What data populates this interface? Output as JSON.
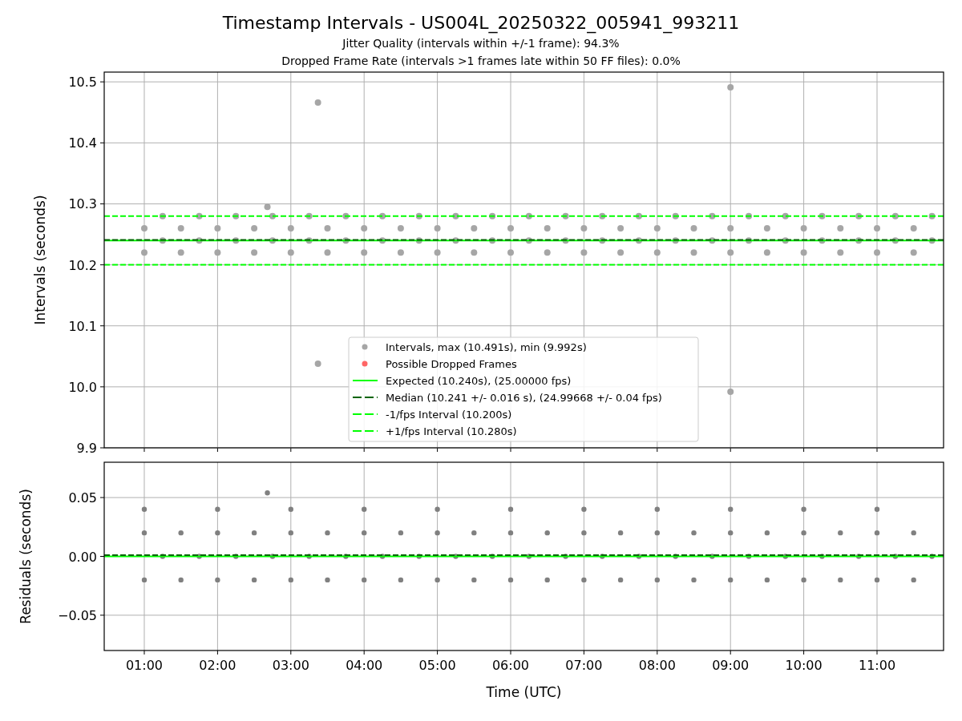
{
  "figure": {
    "title": "Timestamp Intervals - US004L_20250322_005941_993211",
    "subtitles": [
      "Jitter Quality (intervals within +/-1 frame): 94.3%",
      "Dropped Frame Rate (intervals >1 frames late within 50 FF files): 0.0%"
    ]
  },
  "intervals_plot": {
    "chart_data": {
      "type": "scatter",
      "ylabel": "Intervals (seconds)",
      "grid": true,
      "xlim": [
        0.453,
        11.908
      ],
      "ylim": [
        9.9,
        10.516
      ],
      "yticks": [
        {
          "value": 9.9,
          "label": "9.9"
        },
        {
          "value": 10.0,
          "label": "10.0"
        },
        {
          "value": 10.1,
          "label": "10.1"
        },
        {
          "value": 10.2,
          "label": "10.2"
        },
        {
          "value": 10.3,
          "label": "10.3"
        },
        {
          "value": 10.4,
          "label": "10.4"
        },
        {
          "value": 10.5,
          "label": "10.5"
        }
      ],
      "x": [
        1.0,
        1.5,
        2.0,
        2.5,
        3.0,
        3.5,
        4.0,
        4.5,
        5.0,
        5.5,
        6.0,
        6.5,
        7.0,
        7.5,
        8.0,
        8.5,
        9.0,
        9.5,
        10.0,
        10.5,
        11.0,
        11.5,
        1.25,
        1.75,
        2.25,
        2.75,
        3.25,
        3.75,
        4.25,
        4.75,
        5.25,
        5.75,
        6.25,
        6.75,
        7.25,
        7.75,
        8.25,
        8.75,
        9.25,
        9.75,
        10.25,
        10.75,
        11.25,
        11.75,
        1.0,
        1.5,
        2.0,
        2.5,
        3.0,
        3.5,
        4.0,
        4.5,
        5.0,
        5.5,
        6.0,
        6.5,
        7.0,
        7.5,
        8.0,
        8.5,
        9.0,
        9.5,
        10.0,
        10.5,
        11.0,
        11.5,
        1.25,
        1.75,
        2.25,
        2.75,
        3.25,
        3.75,
        4.25,
        4.75,
        5.25,
        5.75,
        6.25,
        6.75,
        7.25,
        7.75,
        8.25,
        8.75,
        9.25,
        9.75,
        10.25,
        10.75,
        11.25,
        11.75,
        2.68,
        3.37,
        3.37,
        9.0,
        9.0
      ],
      "series": [
        {
          "color": "#a6a6a6",
          "values": [
            10.22,
            10.22,
            10.22,
            10.22,
            10.22,
            10.22,
            10.22,
            10.22,
            10.22,
            10.22,
            10.22,
            10.22,
            10.22,
            10.22,
            10.22,
            10.22,
            10.22,
            10.22,
            10.22,
            10.22,
            10.22,
            10.22,
            10.24,
            10.24,
            10.24,
            10.24,
            10.24,
            10.24,
            10.24,
            10.24,
            10.24,
            10.24,
            10.24,
            10.24,
            10.24,
            10.24,
            10.24,
            10.24,
            10.24,
            10.24,
            10.24,
            10.24,
            10.24,
            10.24,
            10.26,
            10.26,
            10.26,
            10.26,
            10.26,
            10.26,
            10.26,
            10.26,
            10.26,
            10.26,
            10.26,
            10.26,
            10.26,
            10.26,
            10.26,
            10.26,
            10.26,
            10.26,
            10.26,
            10.26,
            10.26,
            10.26,
            10.28,
            10.28,
            10.28,
            10.28,
            10.28,
            10.28,
            10.28,
            10.28,
            10.28,
            10.28,
            10.28,
            10.28,
            10.28,
            10.28,
            10.28,
            10.28,
            10.28,
            10.28,
            10.28,
            10.28,
            10.28,
            10.28,
            10.295,
            10.466,
            10.038,
            10.491,
            9.992
          ]
        }
      ],
      "ref_lines": [
        {
          "axis": "y",
          "color": "#00ff00",
          "value": 10.24
        },
        {
          "axis": "y",
          "color": "#006400",
          "value": 10.241
        },
        {
          "axis": "y",
          "color": "#00ff00",
          "value": 10.2
        },
        {
          "axis": "y",
          "color": "#00ff00",
          "value": 10.28
        }
      ]
    },
    "legend": [
      {
        "kind": "marker",
        "label": "Intervals, max (10.491s), min (9.992s)",
        "color": "#a6a6a6"
      },
      {
        "kind": "marker",
        "label": "Possible Dropped Frames",
        "color": "#ff6666"
      },
      {
        "kind": "line",
        "label": "Expected (10.240s), (25.00000 fps)",
        "color": "#00ff00"
      },
      {
        "kind": "dashed_line",
        "label": "Median (10.241 +/- 0.016 s), (24.99668 +/- 0.04 fps)",
        "color": "#006400"
      },
      {
        "kind": "dashed_line",
        "label": "-1/fps Interval (10.200s)",
        "color": "#00ff00"
      },
      {
        "kind": "dashed_line",
        "label": "+1/fps Interval (10.280s)",
        "color": "#00ff00"
      }
    ]
  },
  "residuals_plot": {
    "chart_data": {
      "type": "scatter",
      "xlabel": "Time (UTC)",
      "ylabel": "Residuals (seconds)",
      "grid": true,
      "xlim": [
        0.453,
        11.908
      ],
      "ylim": [
        -0.08,
        0.08
      ],
      "xticks": [
        {
          "value": 1,
          "label": "01:00"
        },
        {
          "value": 2,
          "label": "02:00"
        },
        {
          "value": 3,
          "label": "03:00"
        },
        {
          "value": 4,
          "label": "04:00"
        },
        {
          "value": 5,
          "label": "05:00"
        },
        {
          "value": 6,
          "label": "06:00"
        },
        {
          "value": 7,
          "label": "07:00"
        },
        {
          "value": 8,
          "label": "08:00"
        },
        {
          "value": 9,
          "label": "09:00"
        },
        {
          "value": 10,
          "label": "10:00"
        },
        {
          "value": 11,
          "label": "11:00"
        }
      ],
      "yticks": [
        {
          "value": -0.05,
          "label": "−0.05"
        },
        {
          "value": 0,
          "label": "0.00"
        },
        {
          "value": 0.05,
          "label": "0.05"
        }
      ],
      "x": [
        1.0,
        2.0,
        3.0,
        4.0,
        5.0,
        6.0,
        7.0,
        8.0,
        9.0,
        10.0,
        11.0,
        1.0,
        1.5,
        2.0,
        2.5,
        3.0,
        3.5,
        4.0,
        4.5,
        5.0,
        5.5,
        6.0,
        6.5,
        7.0,
        7.5,
        8.0,
        8.5,
        9.0,
        9.5,
        10.0,
        10.5,
        11.0,
        11.5,
        1.25,
        1.75,
        2.25,
        2.75,
        3.25,
        3.75,
        4.25,
        4.75,
        5.25,
        5.75,
        6.25,
        6.75,
        7.25,
        7.75,
        8.25,
        8.75,
        9.25,
        9.75,
        10.25,
        10.75,
        11.25,
        11.75,
        1.0,
        1.5,
        2.0,
        2.5,
        3.0,
        3.5,
        4.0,
        4.5,
        5.0,
        5.5,
        6.0,
        6.5,
        7.0,
        7.5,
        8.0,
        8.5,
        9.0,
        9.5,
        10.0,
        10.5,
        11.0,
        11.5,
        2.68
      ],
      "series": [
        {
          "color": "#808080",
          "values": [
            0.04,
            0.04,
            0.04,
            0.04,
            0.04,
            0.04,
            0.04,
            0.04,
            0.04,
            0.04,
            0.04,
            0.02,
            0.02,
            0.02,
            0.02,
            0.02,
            0.02,
            0.02,
            0.02,
            0.02,
            0.02,
            0.02,
            0.02,
            0.02,
            0.02,
            0.02,
            0.02,
            0.02,
            0.02,
            0.02,
            0.02,
            0.02,
            0.02,
            0,
            0,
            0,
            0,
            0,
            0,
            0,
            0,
            0,
            0,
            0,
            0,
            0,
            0,
            0,
            0,
            0,
            0,
            0,
            0,
            0,
            0,
            -0.02,
            -0.02,
            -0.02,
            -0.02,
            -0.02,
            -0.02,
            -0.02,
            -0.02,
            -0.02,
            -0.02,
            -0.02,
            -0.02,
            -0.02,
            -0.02,
            -0.02,
            -0.02,
            -0.02,
            -0.02,
            -0.02,
            -0.02,
            -0.02,
            -0.02,
            0.054
          ]
        }
      ],
      "ref_lines": [
        {
          "axis": "y",
          "color": "#00ff00",
          "value": 0
        },
        {
          "axis": "y",
          "color": "#006400",
          "value": 0.001
        }
      ]
    }
  }
}
